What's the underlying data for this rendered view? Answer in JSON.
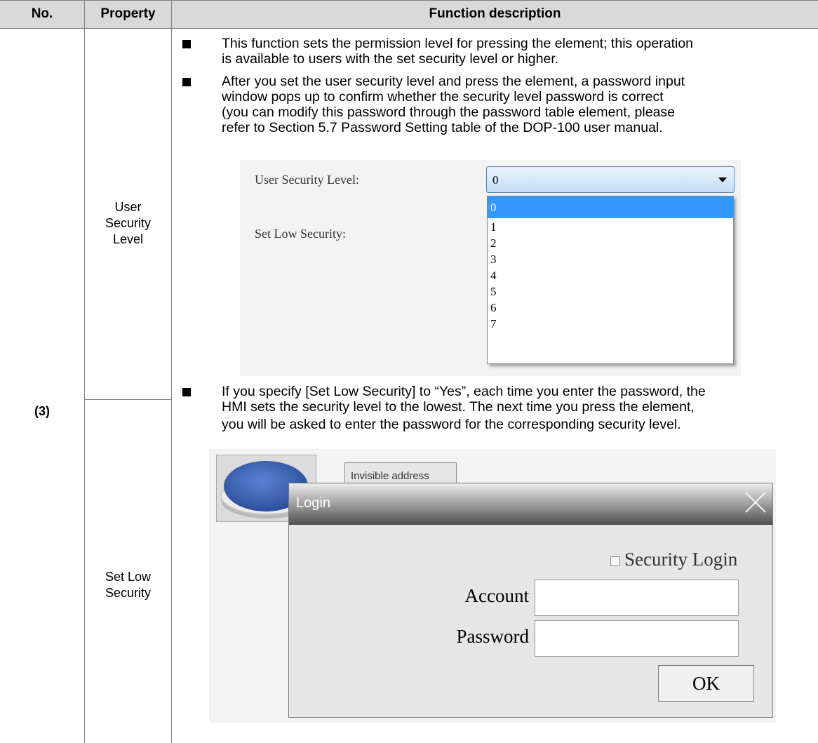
{
  "table": {
    "headers": {
      "no": "No.",
      "property": "Property",
      "description": "Function description"
    },
    "row_no": "(3)",
    "properties": {
      "user_security": [
        "User",
        "Security",
        "Level"
      ],
      "set_low": [
        "Set Low",
        "Security"
      ]
    }
  },
  "bullets": [
    [
      "This function sets the permission level for pressing the element; this operation",
      "is available to users with the set security level or higher."
    ],
    [
      "After you set the user security level and press the element, a password input",
      "window pops up to confirm whether the security level password is correct",
      "(you can modify this password through the password table element, please",
      "refer to Section 5.7 Password Setting table of the DOP-100 user manual."
    ],
    [
      "If you specify [Set Low Security] to “Yes”, each time you enter the password, the",
      "HMI sets the security level to the lowest. The next time you press the element,",
      "you will be asked to enter the password for the corresponding security level."
    ]
  ],
  "dropdown_shot": {
    "user_security_label": "User Security Level:",
    "set_low_label": "Set Low Security:",
    "selected": "0",
    "options": [
      "0",
      "1",
      "2",
      "3",
      "4",
      "5",
      "6",
      "7"
    ]
  },
  "login_shot": {
    "invisible_btn": "Invisible address",
    "title": "Login",
    "security_login": "Security Login",
    "account_label": "Account",
    "password_label": "Password",
    "ok": "OK"
  }
}
